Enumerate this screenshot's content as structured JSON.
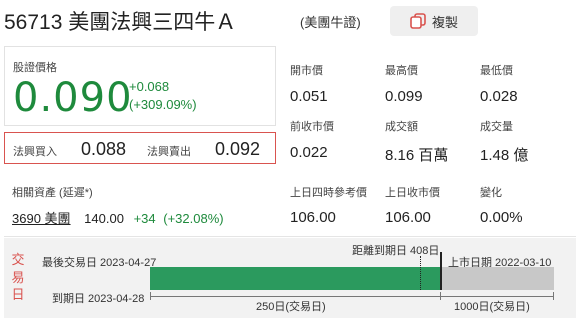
{
  "header": {
    "title": "56713 美團法興三四牛Ａ",
    "subtitle": "(美團牛證)",
    "copy_label": "複製",
    "copy_icon": "copy-icon"
  },
  "quote": {
    "price_label": "股證價格",
    "price": "0.090",
    "change": "+0.068",
    "change_pct": "(+309.09%)"
  },
  "bid_ask": {
    "bid_label": "法興買入",
    "bid": "0.088",
    "ask_label": "法興賣出",
    "ask": "0.092"
  },
  "stats": [
    {
      "label": "開市價",
      "value": "0.051"
    },
    {
      "label": "最高價",
      "value": "0.099"
    },
    {
      "label": "最低價",
      "value": "0.028"
    },
    {
      "label": "前收市價",
      "value": "0.022"
    },
    {
      "label": "成交額",
      "value": "8.16 百萬"
    },
    {
      "label": "成交量",
      "value": "1.48 億"
    }
  ],
  "underlying": {
    "label": "相關資產 (延遲*)",
    "code_name": "3690 美團",
    "price": "140.00",
    "change": "+34",
    "change_pct": "(+32.08%)"
  },
  "ref": [
    {
      "label": "上日四時參考價",
      "value": "106.00"
    },
    {
      "label": "上日收市價",
      "value": "106.00"
    },
    {
      "label": "變化",
      "value": "0.00%"
    }
  ],
  "trading": {
    "side_label": [
      "交",
      "易",
      "日"
    ],
    "last_trading": "最後交易日 2023-04-27",
    "expiry": "到期日 2023-04-28",
    "days_to_expiry": "距離到期日 408日",
    "listing": "上市日期 2022-03-10",
    "elapsed": "250日(交易日)",
    "total": "1000日(交易日)",
    "elapsed_days": 250,
    "total_days": 1000
  },
  "colors": {
    "up": "#1e8a3c",
    "highlight_border": "#d9534f",
    "bar_fill": "#2b9a5e"
  }
}
